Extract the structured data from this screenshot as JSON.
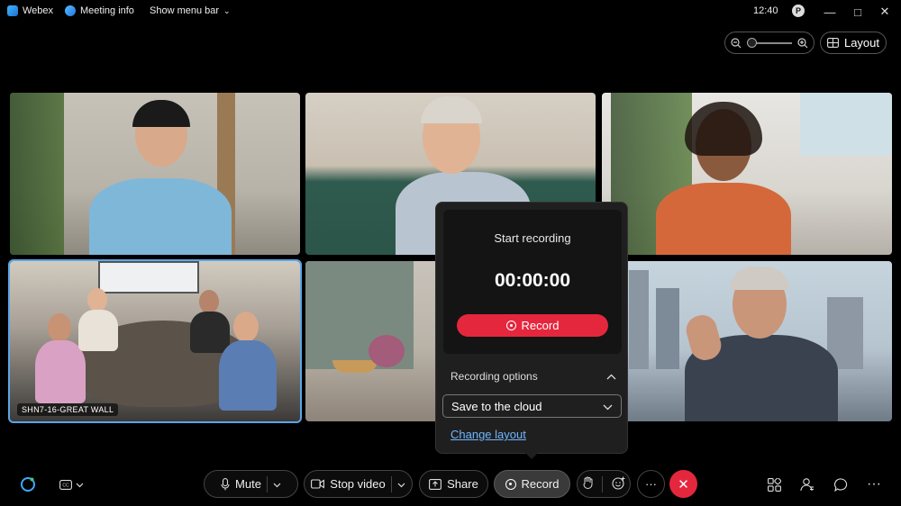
{
  "titlebar": {
    "app_name": "Webex",
    "meeting_info": "Meeting info",
    "show_menu_bar": "Show menu bar",
    "clock": "12:40",
    "avatar_initial": "P"
  },
  "top_controls": {
    "layout_label": "Layout"
  },
  "tiles": [
    {
      "name": "participant-1"
    },
    {
      "name": "participant-2"
    },
    {
      "name": "participant-3"
    },
    {
      "name": "room-system",
      "label": "SHN7-16-GREAT WALL"
    },
    {
      "name": "participant-5"
    },
    {
      "name": "participant-6"
    }
  ],
  "recording_popup": {
    "title": "Start recording",
    "timer": "00:00:00",
    "record_button": "Record",
    "options_label": "Recording options",
    "storage_selected": "Save to the cloud",
    "change_layout_link": "Change layout"
  },
  "toolbar": {
    "mute_label": "Mute",
    "stop_video_label": "Stop video",
    "share_label": "Share",
    "record_label": "Record",
    "more_label": "···",
    "overflow_label": "···"
  },
  "colors": {
    "accent_red": "#e5273e",
    "link_blue": "#6fb6ff",
    "active_tile_border": "#5aa6e8"
  }
}
